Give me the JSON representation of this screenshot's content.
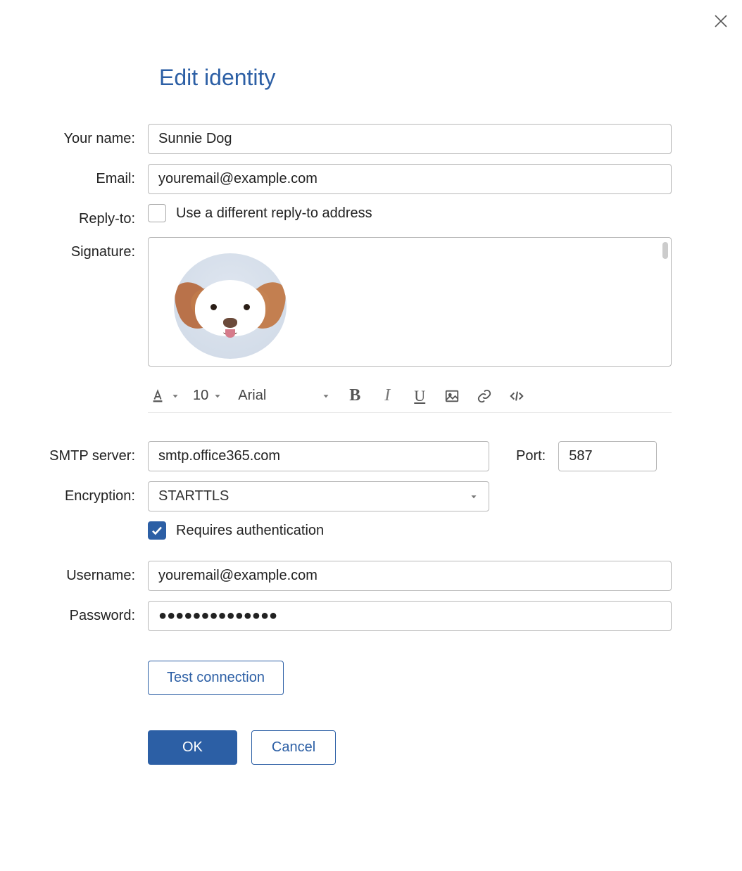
{
  "title": "Edit identity",
  "labels": {
    "your_name": "Your name:",
    "email": "Email:",
    "reply_to": "Reply-to:",
    "signature": "Signature:",
    "smtp_server": "SMTP server:",
    "port": "Port:",
    "encryption": "Encryption:",
    "username": "Username:",
    "password": "Password:"
  },
  "fields": {
    "your_name": "Sunnie Dog",
    "email": "youremail@example.com",
    "reply_to_different": "Use a different reply-to address",
    "smtp_server": "smtp.office365.com",
    "port": "587",
    "encryption": "STARTTLS",
    "requires_auth_label": "Requires authentication",
    "username": "youremail@example.com",
    "password": "●●●●●●●●●●●●●●"
  },
  "toolbar": {
    "font_size": "10",
    "font_name": "Arial"
  },
  "buttons": {
    "test_connection": "Test connection",
    "ok": "OK",
    "cancel": "Cancel"
  }
}
